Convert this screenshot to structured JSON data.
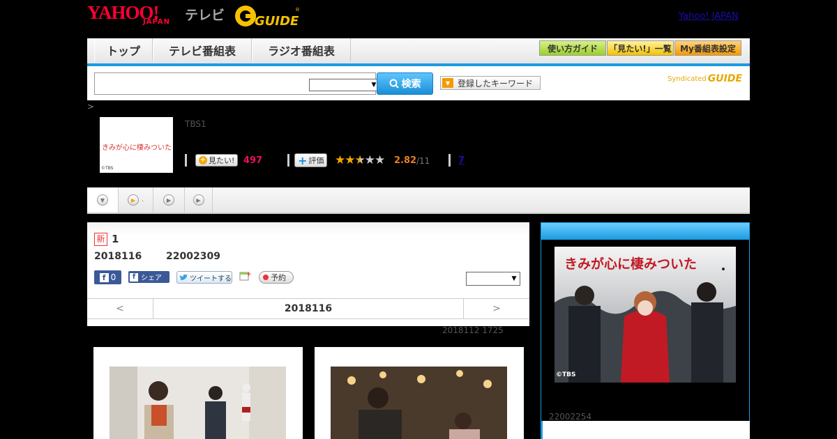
{
  "header": {
    "logo_yahoo": "YAHOO!",
    "logo_japan": "JAPAN",
    "logo_tv": "テレビ",
    "logo_guide": "G GUIDE",
    "top_link": "Yahoo! JAPAN"
  },
  "nav": {
    "tabs": [
      "トップ",
      "テレビ番組表",
      "ラジオ番組表"
    ],
    "buttons": [
      "使い方ガイド",
      "「見たい!」一覧",
      "My番組表設定"
    ]
  },
  "search": {
    "placeholder": "",
    "button_label": "検索",
    "keyword_button": "登録したキーワード",
    "syndicated": "Syndicated",
    "syndicated_brand": "GUIDE"
  },
  "breadcrumb": ">",
  "program": {
    "thumb_title": "きみが心に棲みついた",
    "thumb_copyright": "©TBS",
    "channel": "TBS1",
    "mitai_label": "見たい!",
    "mitai_count": "497",
    "hyouka_label": "評価",
    "rating_value": "2.82",
    "rating_count": "/11",
    "rating_stars": 2.82,
    "link_count": "7"
  },
  "episode": {
    "new_badge": "新",
    "title": "1",
    "date": "2018116",
    "time": "22002309",
    "fb_count": "0",
    "share_label": "シェア",
    "tweet_label": "ツイートする",
    "reserve_label": "予約",
    "pager_prev": "<",
    "pager_date": "2018116",
    "pager_next": ">",
    "updated": "2018112  1725"
  },
  "sidebar": {
    "image_title": "きみが心に棲みついた",
    "image_copyright": "©TBS",
    "date": "22002254"
  },
  "colors": {
    "accent_blue": "#1a9be0",
    "brand_red": "#ff0033",
    "guide_yellow": "#f5c200",
    "mitai_pink": "#e8115f",
    "rating_orange": "#e8801a"
  }
}
